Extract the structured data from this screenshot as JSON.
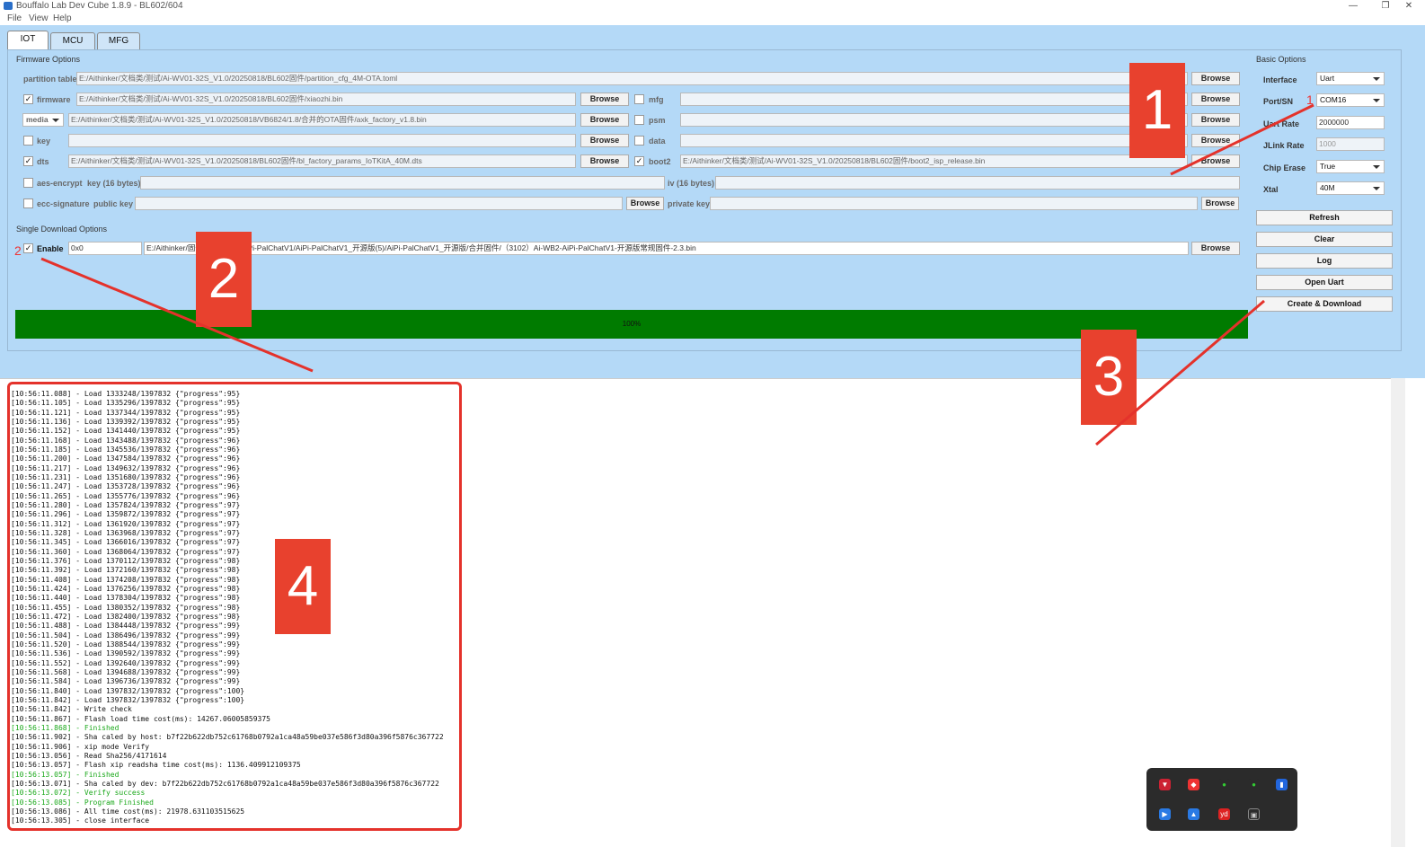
{
  "window": {
    "title": "Bouffalo Lab Dev Cube 1.8.9 - BL602/604",
    "minimize_glyph": "—",
    "maximize_glyph": "❐",
    "close_glyph": "✕"
  },
  "menu": {
    "file": "File",
    "view": "View",
    "help": "Help"
  },
  "tabs": [
    "IOT",
    "MCU",
    "MFG"
  ],
  "firmware": {
    "group_title": "Firmware Options",
    "partition_table": {
      "label": "partition table",
      "value": "E:/Aithinker/文档类/测试/Ai-WV01-32S_V1.0/20250818/BL602固件/partition_cfg_4M-OTA.toml"
    },
    "firmware": {
      "label": "firmware",
      "checked": true,
      "value": "E:/Aithinker/文档类/测试/Ai-WV01-32S_V1.0/20250818/BL602固件/xiaozhi.bin"
    },
    "mfg": {
      "label": "mfg",
      "checked": false,
      "value": ""
    },
    "media": {
      "label": "media",
      "value": "E:/Aithinker/文档类/测试/Ai-WV01-32S_V1.0/20250818/VB6824/1.8/合并的OTA固件/axk_factory_v1.8.bin"
    },
    "psm": {
      "label": "psm",
      "checked": false,
      "value": ""
    },
    "key": {
      "label": "key",
      "checked": false,
      "value": ""
    },
    "data": {
      "label": "data",
      "checked": false,
      "value": ""
    },
    "dts": {
      "label": "dts",
      "checked": true,
      "value": "E:/Aithinker/文档类/测试/Ai-WV01-32S_V1.0/20250818/BL602固件/bl_factory_params_IoTKitA_40M.dts"
    },
    "boot2": {
      "label": "boot2",
      "checked": true,
      "value": "E:/Aithinker/文档类/测试/Ai-WV01-32S_V1.0/20250818/BL602固件/boot2_isp_release.bin"
    },
    "aes_encrypt": {
      "label": "aes-encrypt",
      "checked": false,
      "key_label": "key (16 bytes)",
      "iv_label": "iv (16 bytes)"
    },
    "ecc_signature": {
      "label": "ecc-signature",
      "checked": false,
      "public_key_label": "public key",
      "private_key_label": "private key"
    },
    "browse": "Browse"
  },
  "single_download": {
    "group_title": "Single Download Options",
    "enable_label": "Enable",
    "enable_checked": true,
    "address": "0x0",
    "path": "E:/Aithinker/固件类/Ai-WB2/AiPi-PalChatV1/AiPi-PalChatV1_开源版(5)/AiPi-PalChatV1_开源版/合并固件/（3102）Ai-WB2-AiPi-PalChatV1-开源版常规固件-2.3.bin"
  },
  "progress": {
    "percent": 100,
    "label": "100%"
  },
  "basic": {
    "group_title": "Basic Options",
    "interface": {
      "label": "Interface",
      "value": "Uart"
    },
    "port": {
      "label": "Port/SN",
      "value": "COM16"
    },
    "uart_rate": {
      "label": "Uart Rate",
      "value": "2000000"
    },
    "jlink_rate": {
      "label": "JLink Rate",
      "value": "1000"
    },
    "chip_erase": {
      "label": "Chip Erase",
      "value": "True"
    },
    "xtal": {
      "label": "Xtal",
      "value": "40M"
    },
    "buttons": {
      "refresh": "Refresh",
      "clear": "Clear",
      "log": "Log",
      "open_uart": "Open Uart",
      "create_download": "Create & Download"
    }
  },
  "log": [
    {
      "t": "10:56:11.088",
      "m": "Load 1333248/1397832 {\"progress\":95}"
    },
    {
      "t": "10:56:11.105",
      "m": "Load 1335296/1397832 {\"progress\":95}"
    },
    {
      "t": "10:56:11.121",
      "m": "Load 1337344/1397832 {\"progress\":95}"
    },
    {
      "t": "10:56:11.136",
      "m": "Load 1339392/1397832 {\"progress\":95}"
    },
    {
      "t": "10:56:11.152",
      "m": "Load 1341440/1397832 {\"progress\":95}"
    },
    {
      "t": "10:56:11.168",
      "m": "Load 1343488/1397832 {\"progress\":96}"
    },
    {
      "t": "10:56:11.185",
      "m": "Load 1345536/1397832 {\"progress\":96}"
    },
    {
      "t": "10:56:11.200",
      "m": "Load 1347584/1397832 {\"progress\":96}"
    },
    {
      "t": "10:56:11.217",
      "m": "Load 1349632/1397832 {\"progress\":96}"
    },
    {
      "t": "10:56:11.231",
      "m": "Load 1351680/1397832 {\"progress\":96}"
    },
    {
      "t": "10:56:11.247",
      "m": "Load 1353728/1397832 {\"progress\":96}"
    },
    {
      "t": "10:56:11.265",
      "m": "Load 1355776/1397832 {\"progress\":96}"
    },
    {
      "t": "10:56:11.280",
      "m": "Load 1357824/1397832 {\"progress\":97}"
    },
    {
      "t": "10:56:11.296",
      "m": "Load 1359872/1397832 {\"progress\":97}"
    },
    {
      "t": "10:56:11.312",
      "m": "Load 1361920/1397832 {\"progress\":97}"
    },
    {
      "t": "10:56:11.328",
      "m": "Load 1363968/1397832 {\"progress\":97}"
    },
    {
      "t": "10:56:11.345",
      "m": "Load 1366016/1397832 {\"progress\":97}"
    },
    {
      "t": "10:56:11.360",
      "m": "Load 1368064/1397832 {\"progress\":97}"
    },
    {
      "t": "10:56:11.376",
      "m": "Load 1370112/1397832 {\"progress\":98}"
    },
    {
      "t": "10:56:11.392",
      "m": "Load 1372160/1397832 {\"progress\":98}"
    },
    {
      "t": "10:56:11.408",
      "m": "Load 1374208/1397832 {\"progress\":98}"
    },
    {
      "t": "10:56:11.424",
      "m": "Load 1376256/1397832 {\"progress\":98}"
    },
    {
      "t": "10:56:11.440",
      "m": "Load 1378304/1397832 {\"progress\":98}"
    },
    {
      "t": "10:56:11.455",
      "m": "Load 1380352/1397832 {\"progress\":98}"
    },
    {
      "t": "10:56:11.472",
      "m": "Load 1382400/1397832 {\"progress\":98}"
    },
    {
      "t": "10:56:11.488",
      "m": "Load 1384448/1397832 {\"progress\":99}"
    },
    {
      "t": "10:56:11.504",
      "m": "Load 1386496/1397832 {\"progress\":99}"
    },
    {
      "t": "10:56:11.520",
      "m": "Load 1388544/1397832 {\"progress\":99}"
    },
    {
      "t": "10:56:11.536",
      "m": "Load 1390592/1397832 {\"progress\":99}"
    },
    {
      "t": "10:56:11.552",
      "m": "Load 1392640/1397832 {\"progress\":99}"
    },
    {
      "t": "10:56:11.568",
      "m": "Load 1394688/1397832 {\"progress\":99}"
    },
    {
      "t": "10:56:11.584",
      "m": "Load 1396736/1397832 {\"progress\":99}"
    },
    {
      "t": "10:56:11.840",
      "m": "Load 1397832/1397832 {\"progress\":100}"
    },
    {
      "t": "10:56:11.842",
      "m": "Load 1397832/1397832 {\"progress\":100}"
    },
    {
      "t": "10:56:11.842",
      "m": "Write check"
    },
    {
      "t": "10:56:11.867",
      "m": "Flash load time cost(ms): 14267.06005859375"
    },
    {
      "t": "10:56:11.868",
      "m": "Finished",
      "green": true
    },
    {
      "t": "10:56:11.902",
      "m": "Sha caled by host: b7f22b622db752c61768b0792a1ca48a59be037e586f3d80a396f5876c367722"
    },
    {
      "t": "10:56:11.906",
      "m": "xip mode Verify"
    },
    {
      "t": "10:56:13.056",
      "m": "Read Sha256/4171614"
    },
    {
      "t": "10:56:13.057",
      "m": "Flash xip readsha time cost(ms): 1136.409912109375"
    },
    {
      "t": "10:56:13.057",
      "m": "Finished",
      "green": true
    },
    {
      "t": "10:56:13.071",
      "m": "Sha caled by dev: b7f22b622db752c61768b0792a1ca48a59be037e586f3d80a396f5876c367722"
    },
    {
      "t": "10:56:13.072",
      "m": "Verify success",
      "green": true
    },
    {
      "t": "10:56:13.085",
      "m": "Program Finished",
      "green": true
    },
    {
      "t": "10:56:13.086",
      "m": "All time cost(ms): 21978.631103515625"
    },
    {
      "t": "10:56:13.305",
      "m": "close interface"
    }
  ],
  "annotations": {
    "box1": "1",
    "box2": "2",
    "box3": "3",
    "box4": "4",
    "small1": "1",
    "small2": "2"
  },
  "colors": {
    "accent_red": "#e8412e",
    "progress_green": "#007b00",
    "panel_bg": "#b4d9f7"
  }
}
